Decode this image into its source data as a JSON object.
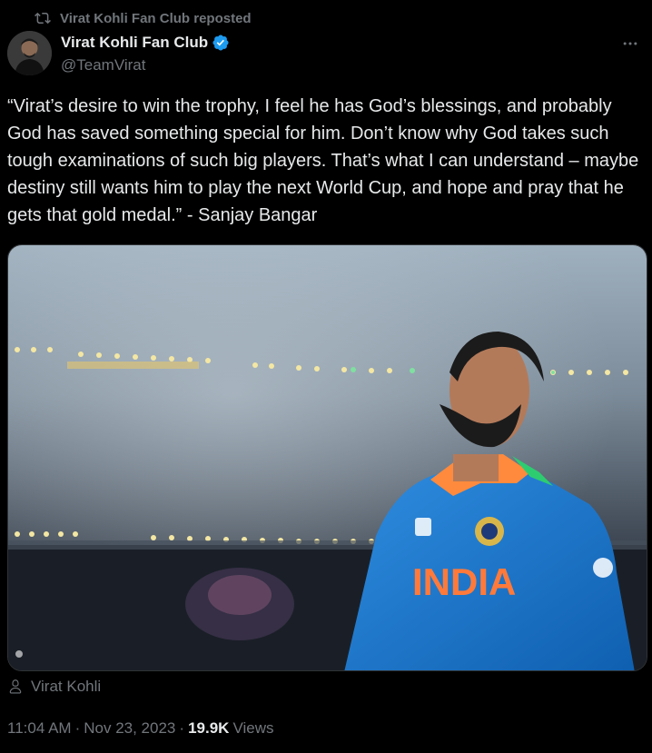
{
  "repost": {
    "label": "Virat Kohli Fan Club reposted",
    "icon": "repost-icon"
  },
  "author": {
    "name": "Virat Kohli Fan Club",
    "handle": "@TeamVirat",
    "verified": true,
    "badge_color": "#1d9bf0"
  },
  "tweet": {
    "text": "“Virat’s desire to win the trophy, I feel he has God’s blessings, and probably God has saved something special for him. Don’t know why God takes such tough examinations of such big players. That’s what I can understand – maybe destiny still wants him to play the next World Cup, and hope and pray that he gets that gold medal.” - Sanjay Bangar"
  },
  "media": {
    "jersey_text": "INDIA",
    "jersey_color": "#1a7fd6"
  },
  "tagged_user": {
    "icon": "person-icon",
    "name": "Virat Kohli"
  },
  "meta": {
    "time": "11:04 AM",
    "sep1": "·",
    "date": "Nov 23, 2023",
    "sep2": "·",
    "views_count": "19.9K",
    "views_label": "Views"
  }
}
